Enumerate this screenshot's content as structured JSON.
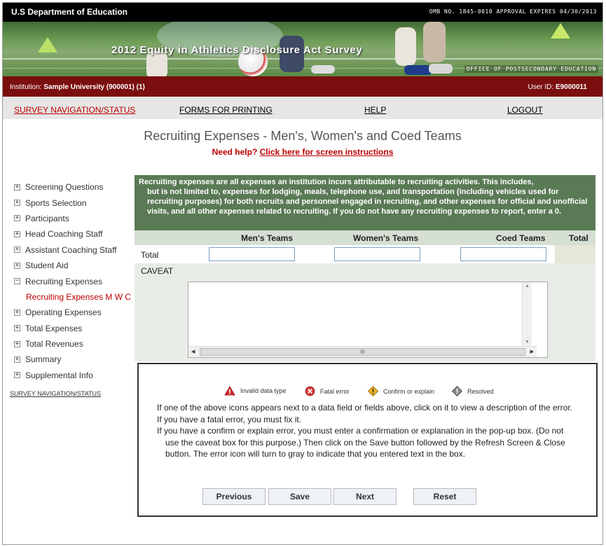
{
  "topbar": {
    "dept": "U.S Department of Education",
    "omb": "OMB NO. 1845-0010 APPROVAL EXPIRES 04/30/2013"
  },
  "banner": {
    "title": "2012 Equity in Athletics Disclosure Act Survey",
    "office": "OFFICE OF POSTSECONDARY EDUCATION"
  },
  "institution": {
    "label": "Institution:",
    "name": "Sample University (900001) (1)",
    "user_label": "User ID:",
    "user_id": "E9000011"
  },
  "nav": {
    "survey": "SURVEY NAVIGATION/STATUS",
    "forms": "FORMS FOR PRINTING",
    "help": "HELP",
    "logout": "LOGOUT"
  },
  "page": {
    "title": "Recruiting Expenses - Men's, Women's and Coed Teams",
    "need_help": "Need help?",
    "help_link": "Click here for screen instructions"
  },
  "sidebar": {
    "items": [
      "Screening Questions",
      "Sports Selection",
      "Participants",
      "Head Coaching Staff",
      "Assistant Coaching Staff",
      "Student Aid",
      "Recruiting Expenses",
      "Recruiting Expenses M W C",
      "Operating Expenses",
      "Total Expenses",
      "Total Revenues",
      "Summary",
      "Supplemental Info"
    ],
    "survey_nav": "SURVEY NAVIGATION/STATUS"
  },
  "form": {
    "description": [
      "Recruiting expenses are all expenses an institution incurs attributable to recruiting activities.  This includes,",
      "but is not limited to, expenses for lodging, meals, telephone use, and transportation (including vehicles used for recruiting purposes) for both recruits and personnel engaged in recruiting, and other expenses for official and unofficial visits, and all other expenses related to recruiting.  If you do not have any recruiting expenses to report, enter a 0."
    ],
    "columns": {
      "mens": "Men's Teams",
      "womens": "Women's Teams",
      "coed": "Coed Teams",
      "total": "Total"
    },
    "row_label": "Total",
    "values": {
      "mens": "",
      "womens": "",
      "coed": ""
    },
    "caveat_label": "CAVEAT",
    "caveat_value": "",
    "scroll_thumb": "III"
  },
  "legend": {
    "invalid": "Invalid data type",
    "fatal": "Fatal error",
    "confirm": "Confirm or explain",
    "resolved": "Resolved"
  },
  "instructions": [
    "If one of the above icons appears next to a data field or fields above, click on it to view a description of the error.",
    "If you have a fatal error, you must fix it.",
    "If you have a confirm or explain error, you must enter a confirmation or explanation in the pop-up box. (Do not use the caveat box for this purpose.) Then click on the Save button followed by the Refresh Screen & Close button. The error icon will turn to gray to indicate that you entered text in the box."
  ],
  "buttons": {
    "previous": "Previous",
    "save": "Save",
    "next": "Next",
    "reset": "Reset"
  },
  "colors": {
    "header_black": "#000000",
    "institution_bar": "#7b0e0e",
    "accent_red": "#bb0000",
    "description_green": "#5a7a55",
    "column_header": "#d6dfd3"
  }
}
